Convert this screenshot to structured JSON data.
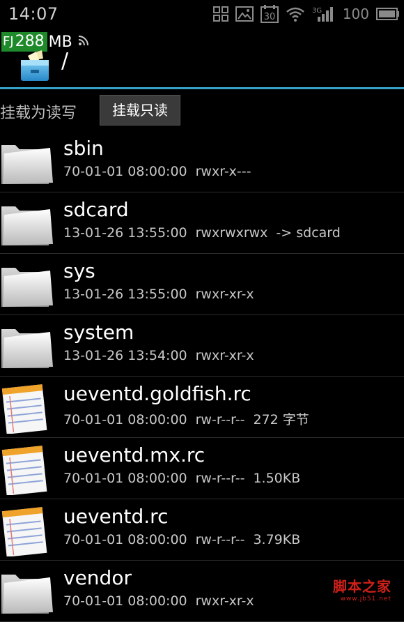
{
  "status_bar": {
    "time": "14:07",
    "network": "3G",
    "battery": "100",
    "icons": [
      "apps-grid-icon",
      "image-icon",
      "calendar-30-icon",
      "wifi-icon",
      "3g-signal-icon",
      "battery-icon"
    ]
  },
  "header": {
    "memory_prefix": "FJ",
    "memory_value": "288",
    "memory_unit": "MB",
    "path": "/",
    "accent_color": "#36a3c9"
  },
  "mount": {
    "label": "挂载为读写",
    "button": "挂载只读"
  },
  "files": [
    {
      "name": "sbin",
      "date": "70-01-01 08:00:00",
      "perm": "rwxr-x---",
      "extra": "",
      "type": "folder"
    },
    {
      "name": "sdcard",
      "date": "13-01-26 13:55:00",
      "perm": "rwxrwxrwx",
      "extra": "-> sdcard",
      "type": "folder"
    },
    {
      "name": "sys",
      "date": "13-01-26 13:55:00",
      "perm": "rwxr-xr-x",
      "extra": "",
      "type": "folder"
    },
    {
      "name": "system",
      "date": "13-01-26 13:54:00",
      "perm": "rwxr-xr-x",
      "extra": "",
      "type": "folder"
    },
    {
      "name": "ueventd.goldfish.rc",
      "date": "70-01-01 08:00:00",
      "perm": "rw-r--r--",
      "extra": "272 字节",
      "type": "file"
    },
    {
      "name": "ueventd.mx.rc",
      "date": "70-01-01 08:00:00",
      "perm": "rw-r--r--",
      "extra": "1.50KB",
      "type": "file"
    },
    {
      "name": "ueventd.rc",
      "date": "70-01-01 08:00:00",
      "perm": "rw-r--r--",
      "extra": "3.79KB",
      "type": "file"
    },
    {
      "name": "vendor",
      "date": "70-01-01 08:00:00",
      "perm": "rwxr-xr-x",
      "extra": "",
      "type": "folder"
    }
  ],
  "watermark": {
    "title": "脚本之家",
    "url": "www.jb51.net"
  }
}
